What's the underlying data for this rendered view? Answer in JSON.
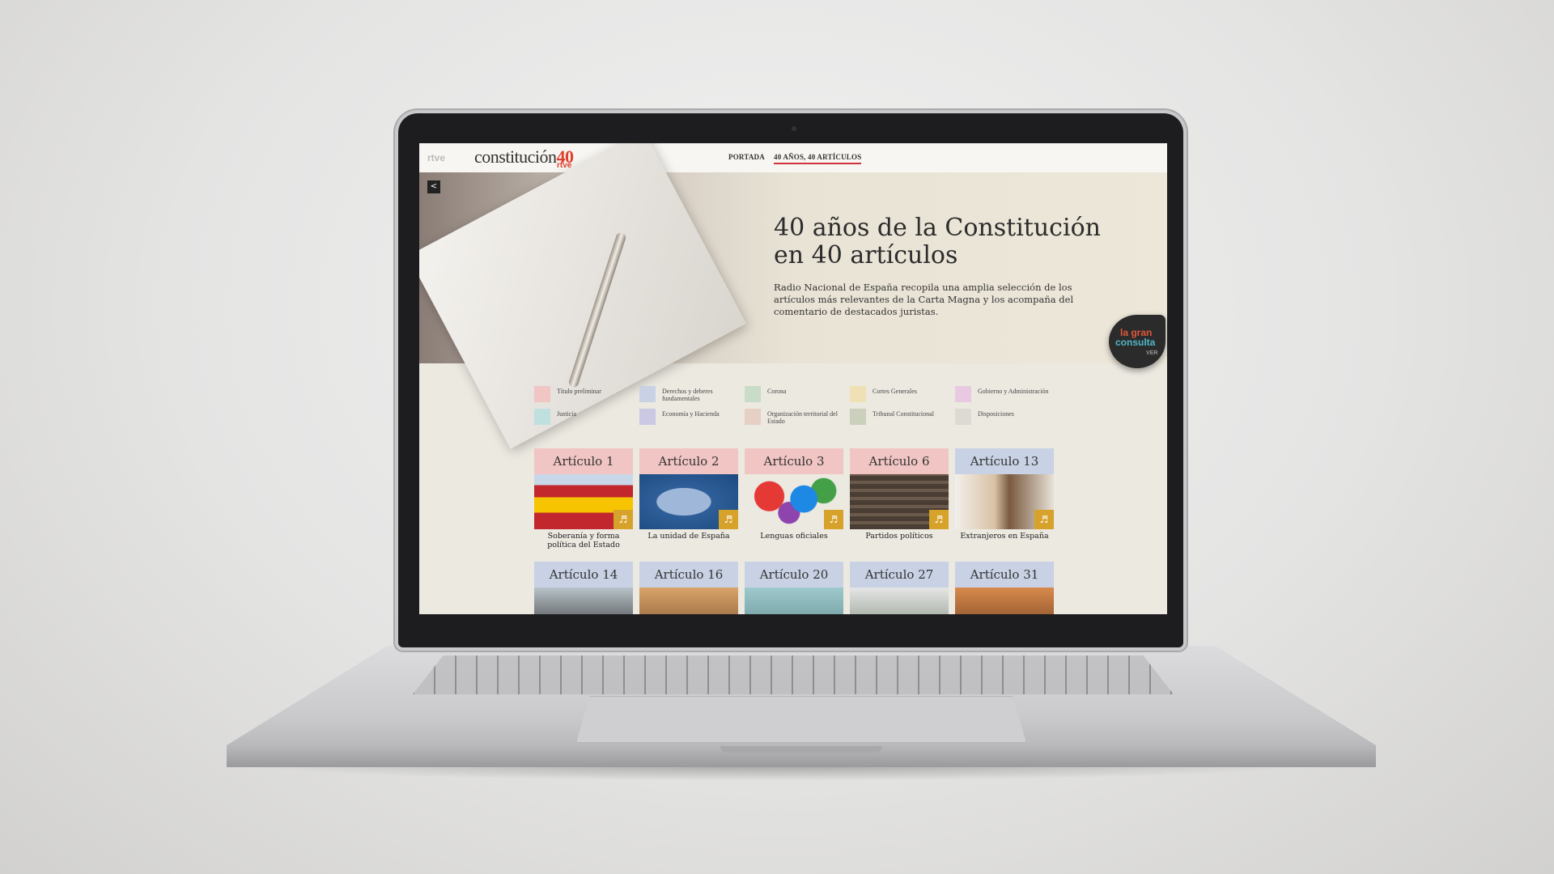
{
  "site": {
    "rtve_small": "rtve",
    "logo_text": "constitución",
    "logo_num": "40",
    "logo_sub": "rtve",
    "nav": [
      "PORTADA",
      "40 AÑOS, 40 ARTÍCULOS"
    ]
  },
  "hero": {
    "title_line1": "40 años de la Constitución",
    "title_line2": "en 40 artículos",
    "description": "Radio Nacional de España recopila una amplia selección de los artículos más relevantes de la Carta Magna y los acompaña del comentario de destacados juristas.",
    "badge": [
      "la gran",
      "consulta",
      "VER"
    ]
  },
  "legend": [
    {
      "label": "Título preliminar",
      "color": "#f0c5c3"
    },
    {
      "label": "Derechos y deberes fundamentales",
      "color": "#c8d2e4"
    },
    {
      "label": "Corona",
      "color": "#c9dcc8"
    },
    {
      "label": "Cortes Generales",
      "color": "#efe0b6"
    },
    {
      "label": "Gobierno y Administración",
      "color": "#e9c9e2"
    },
    {
      "label": "Justicia",
      "color": "#bfe0df"
    },
    {
      "label": "Economía y Hacienda",
      "color": "#cac8e2"
    },
    {
      "label": "Organización territorial del Estado",
      "color": "#e6cfc4"
    },
    {
      "label": "Tribunal Constitucional",
      "color": "#cbd0bd"
    },
    {
      "label": "Disposiciones",
      "color": "#dcdad3"
    }
  ],
  "articles_row1": [
    {
      "title": "Artículo 1",
      "caption": "Soberanía y forma política del Estado",
      "head_color": "#f0c5c3",
      "img_icon": "spain-flag-icon"
    },
    {
      "title": "Artículo 2",
      "caption": "La unidad de España",
      "head_color": "#f0c5c3",
      "img_icon": "spain-map-icon"
    },
    {
      "title": "Artículo 3",
      "caption": "Lenguas oficiales",
      "head_color": "#f0c5c3",
      "img_icon": "speech-bubbles-icon"
    },
    {
      "title": "Artículo 6",
      "caption": "Partidos políticos",
      "head_color": "#f0c5c3",
      "img_icon": "parliament-icon"
    },
    {
      "title": "Artículo 13",
      "caption": "Extranjeros en España",
      "head_color": "#c8d2e4",
      "img_icon": "handshake-icon"
    }
  ],
  "articles_row2": [
    {
      "title": "Artículo 14",
      "head_color": "#c8d2e4"
    },
    {
      "title": "Artículo 16",
      "head_color": "#c8d2e4"
    },
    {
      "title": "Artículo 20",
      "head_color": "#c8d2e4"
    },
    {
      "title": "Artículo 27",
      "head_color": "#c8d2e4"
    },
    {
      "title": "Artículo 31",
      "head_color": "#c8d2e4"
    }
  ],
  "icons": {
    "share": "share-icon",
    "sound": "speaker-icon"
  }
}
